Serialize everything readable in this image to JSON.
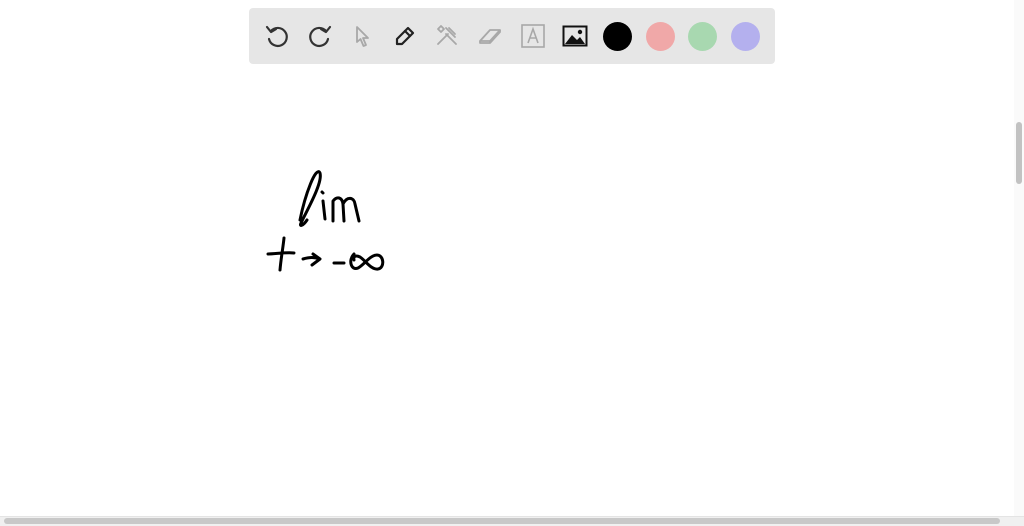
{
  "toolbar": {
    "tools": [
      {
        "name": "undo",
        "icon": "undo-icon"
      },
      {
        "name": "redo",
        "icon": "redo-icon"
      },
      {
        "name": "select",
        "icon": "pointer-icon"
      },
      {
        "name": "pen",
        "icon": "pen-icon"
      },
      {
        "name": "tools",
        "icon": "tools-icon"
      },
      {
        "name": "eraser",
        "icon": "eraser-icon"
      },
      {
        "name": "text",
        "icon": "text-box-icon"
      },
      {
        "name": "image",
        "icon": "image-icon"
      }
    ],
    "colors": [
      "#000000",
      "#f0a8a8",
      "#a8d8b0",
      "#b4b0ee"
    ]
  },
  "canvas": {
    "handwriting": {
      "line1": "lim",
      "line2": "t → -∞"
    }
  }
}
